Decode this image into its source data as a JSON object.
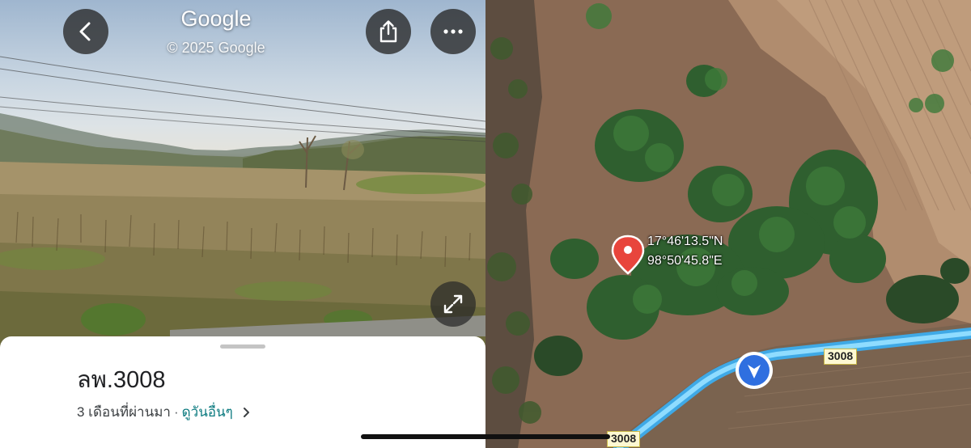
{
  "streetview": {
    "title": "Google",
    "copyright": "© 2025 Google",
    "buttons": {
      "back": "back-arrow-icon",
      "share": "share-icon",
      "more": "more-horizontal-icon",
      "expand": "expand-icon"
    }
  },
  "sheet": {
    "title": "ลพ.3008",
    "date_text": "3 เดือนที่ผ่านมา",
    "separator": "·",
    "more_link": "ดูวันอื่นๆ"
  },
  "map": {
    "coords": {
      "lat": "17°46'13.5\"N",
      "lng": "98°50'45.8\"E"
    },
    "road_labels": [
      "3008",
      "3008"
    ],
    "colors": {
      "pin": "#e8453c",
      "road": "#4fc3f7",
      "direction": "#2f6fe0"
    }
  }
}
